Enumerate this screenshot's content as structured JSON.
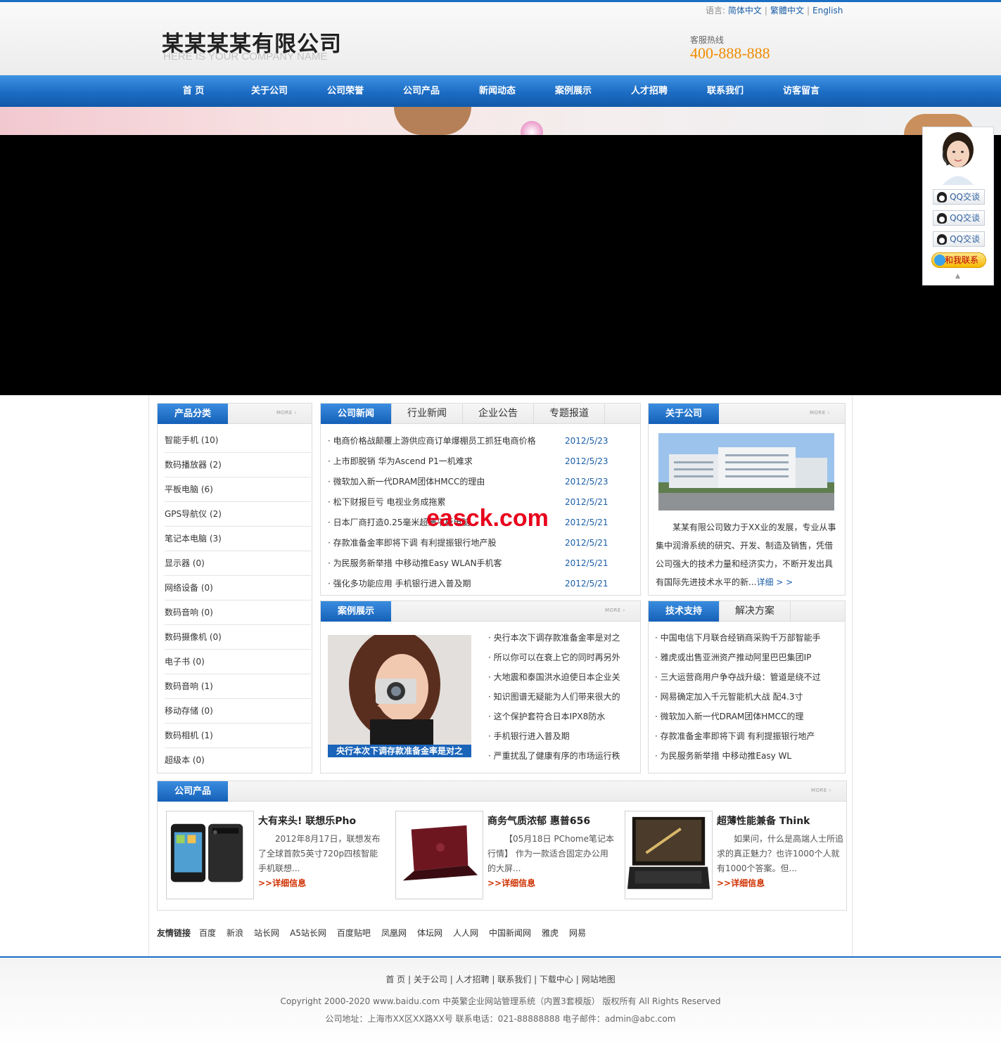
{
  "header": {
    "company_cn": "某某某某有限公司",
    "company_en": "HERE IS YOUR COMPANY NAME",
    "lang_label": "语言:",
    "languages": [
      "简体中文",
      "繁體中文",
      "English"
    ],
    "hotline_label": "客服热线",
    "hotline": "400-888-888"
  },
  "nav": [
    "首 页",
    "关于公司",
    "公司荣誉",
    "公司产品",
    "新闻动态",
    "案例展示",
    "人才招聘",
    "联系我们",
    "访客留言"
  ],
  "qq_panel": {
    "buttons": [
      "QQ交谈",
      "QQ交谈",
      "QQ交谈"
    ],
    "contact": "和我联系",
    "toggle": "▲"
  },
  "categories": {
    "title": "产品分类",
    "more": "MORE ›",
    "items": [
      "智能手机 (10)",
      "数码播放器 (2)",
      "平板电脑 (6)",
      "GPS导航仪 (2)",
      "笔记本电脑 (3)",
      "显示器 (0)",
      "网络设备 (0)",
      "数码音响 (0)",
      "数码摄像机 (0)",
      "电子书 (0)",
      "数码音响 (1)",
      "移动存储 (0)",
      "数码相机 (1)",
      "超级本 (0)"
    ]
  },
  "news": {
    "tabs": [
      "公司新闻",
      "行业新闻",
      "企业公告",
      "专题报道"
    ],
    "items": [
      {
        "title": "· 电商价格战颠覆上游供应商订单爆棚员工抓狂电商价格",
        "date": "2012/5/23"
      },
      {
        "title": "· 上市即脱销 华为Ascend P1一机难求",
        "date": "2012/5/23"
      },
      {
        "title": "· 微软加入新一代DRAM团体HMCC的理由",
        "date": "2012/5/23"
      },
      {
        "title": "· 松下财报巨亏 电视业务成拖累",
        "date": "2012/5/21"
      },
      {
        "title": "· 日本厂商打造0.25毫米超薄平板电脑",
        "date": "2012/5/21"
      },
      {
        "title": "· 存款准备金率即将下调 有利提振银行地产股",
        "date": "2012/5/21"
      },
      {
        "title": "· 为民服务新举措 中移动推Easy WLAN手机客",
        "date": "2012/5/21"
      },
      {
        "title": "· 强化多功能应用 手机银行进入普及期",
        "date": "2012/5/21"
      }
    ]
  },
  "about": {
    "title": "关于公司",
    "more": "MORE ›",
    "text": "某某有限公司致力于XX业的发展，专业从事集中润滑系统的研究、开发、制造及销售，凭借公司强大的技术力量和经济实力，不断开发出具有国际先进技术水平的新...",
    "detail_link": "详细 > >"
  },
  "cases": {
    "title": "案例展示",
    "more": "MORE ›",
    "caption": "央行本次下调存款准备金率是对之",
    "items": [
      "· 央行本次下调存款准备金率是对之",
      "· 所以你可以在衰上它的同时再另外",
      "· 大地震和泰国洪水迫使日本企业关",
      "· 知识图谱无疑能为人们带来很大的",
      "· 这个保护套符合日本IPX8防水",
      "· 手机银行进入普及期",
      "· 严重扰乱了健康有序的市场运行秩"
    ]
  },
  "tech": {
    "tabs": [
      "技术支持",
      "解决方案"
    ],
    "items": [
      "· 中国电信下月联合经销商采购千万部智能手",
      "· 雅虎或出售亚洲资产推动阿里巴巴集团IP",
      "· 三大运营商用户争夺战升级：管道是绕不过",
      "· 网易确定加入千元智能机大战 配4.3寸",
      "· 微软加入新一代DRAM团体HMCC的理",
      "· 存款准备金率即将下调 有利提振银行地产",
      "· 为民服务新举措 中移动推Easy WL"
    ]
  },
  "products": {
    "title": "公司产品",
    "more": "MORE ›",
    "items": [
      {
        "title": "大有来头! 联想乐Pho",
        "desc": "2012年8月17日，联想发布了全球首款5英寸720p四核智能手机联想...",
        "more": ">>详细信息"
      },
      {
        "title": "商务气质浓郁 惠普656",
        "desc": "【05月18日 PChome笔记本行情】 作为一款适合固定办公用的大屏...",
        "more": ">>详细信息"
      },
      {
        "title": "超薄性能兼备 Think",
        "desc": "如果问，什么是高端人士所追求的真正魅力？也许1000个人就有1000个答案。但...",
        "more": ">>详细信息"
      }
    ]
  },
  "links": {
    "label": "友情链接",
    "items": [
      "百度",
      "新浪",
      "站长网",
      "A5站长网",
      "百度贴吧",
      "凤凰网",
      "体坛网",
      "人人网",
      "中国新闻网",
      "雅虎",
      "网易"
    ]
  },
  "footer": {
    "nav": [
      "首 页",
      "关于公司",
      "人才招聘",
      "联系我们",
      "下载中心",
      "网站地图"
    ],
    "copyright": "Copyright 2000-2020 www.baidu.com 中英繁企业网站管理系统（内置3套模版） 版权所有 All Rights Reserved",
    "address": "公司地址：上海市XX区XX路XX号 联系电话：021-88888888 电子邮件：admin@abc.com"
  },
  "watermark": "easck.com",
  "colors": {
    "brand_blue": "#1a6fc4",
    "hotline_orange": "#f08c00",
    "link_blue": "#1a5ea8"
  }
}
